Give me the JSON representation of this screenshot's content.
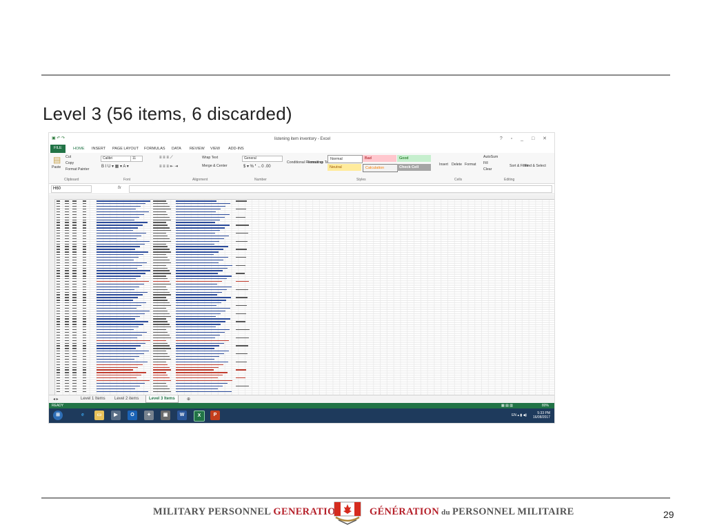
{
  "slide": {
    "title": "Level 3 (56 items, 6 discarded)",
    "page_number": "29"
  },
  "footer": {
    "org_en_prefix": "MILITARY PERSONNEL ",
    "org_en_highlight": "GENERATION",
    "org_fr_highlight": "GÉNÉRATION",
    "org_fr_middle": " du ",
    "org_fr_suffix": "PERSONNEL MILITAIRE"
  },
  "excel": {
    "window_title": "listening item inventory - Excel",
    "tabs": [
      "FILE",
      "HOME",
      "INSERT",
      "PAGE LAYOUT",
      "FORMULAS",
      "DATA",
      "REVIEW",
      "VIEW",
      "ADD-INS"
    ],
    "clipboard": {
      "paste": "Paste",
      "cut": "Cut",
      "copy": "Copy",
      "format_painter": "Format Painter",
      "group": "Clipboard"
    },
    "font": {
      "name": "Calibri",
      "size": "11",
      "group": "Font"
    },
    "alignment": {
      "wrap_text": "Wrap Text",
      "merge_center": "Merge & Center",
      "group": "Alignment"
    },
    "number": {
      "format": "General",
      "group": "Number"
    },
    "styles": {
      "conditional": "Conditional Formatting",
      "format_as_table": "Format as Table",
      "normal": "Normal",
      "bad": "Bad",
      "good": "Good",
      "neutral": "Neutral",
      "calculation": "Calculation",
      "check_cell": "Check Cell",
      "group": "Styles"
    },
    "cells": {
      "insert": "Insert",
      "delete": "Delete",
      "format": "Format",
      "group": "Cells"
    },
    "editing": {
      "autosum": "AutoSum",
      "fill": "Fill",
      "clear": "Clear",
      "sort_filter": "Sort & Filter",
      "find_select": "Find & Select",
      "group": "Editing"
    },
    "name_box": "H60",
    "fx": "fx",
    "sheet_tabs": [
      "Level 1 Items",
      "Level 2 items",
      "Level 3 Items"
    ],
    "active_sheet": "Level 3 Items",
    "status": "READY",
    "zoom": "80%"
  },
  "taskbar": {
    "language": "EN",
    "time": "5:33 PM",
    "date": "16/08/2017"
  },
  "colors": {
    "excel_green": "#217346",
    "taskbar": "#1e3a5c",
    "accent_red": "#b5202a"
  }
}
